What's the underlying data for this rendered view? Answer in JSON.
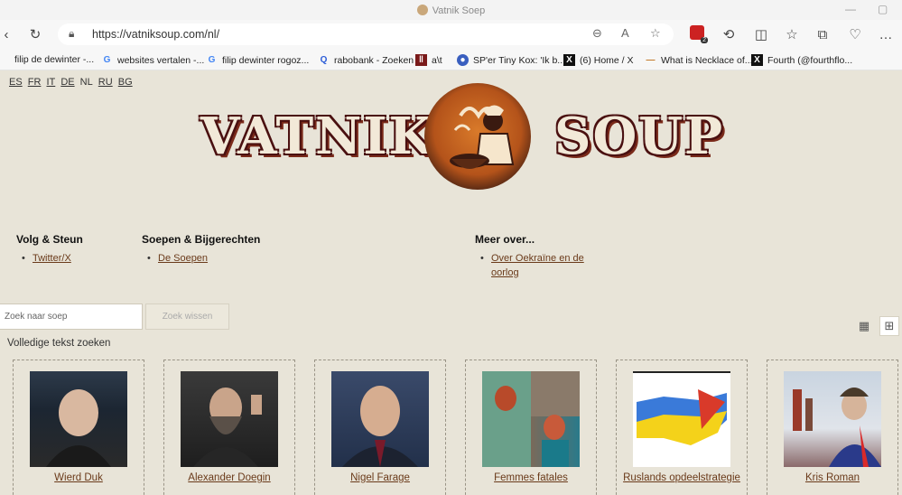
{
  "browser": {
    "tab_title": "Vatnik Soep",
    "url": "https://vatniksoup.com/nl/",
    "extension_badge": "2",
    "bookmarks": [
      {
        "icon": "globe-icon",
        "label": "filip de dewinter -..."
      },
      {
        "icon": "google-icon",
        "label": "websites vertalen -..."
      },
      {
        "icon": "google-icon",
        "label": "filip dewinter rogoz..."
      },
      {
        "icon": "search-icon",
        "label": "rabobank - Zoeken"
      },
      {
        "icon": "site-icon",
        "label": "a\\t"
      },
      {
        "icon": "site-icon",
        "label": "SP'er Tiny Kox: 'Ik b..."
      },
      {
        "icon": "x-icon",
        "label": "(6) Home / X"
      },
      {
        "icon": "dash-icon",
        "label": "What is Necklace of..."
      },
      {
        "icon": "x-icon",
        "label": "Fourth (@fourthflo..."
      }
    ]
  },
  "page": {
    "languages": [
      {
        "code": "ES",
        "link": true
      },
      {
        "code": "FR",
        "link": true
      },
      {
        "code": "IT",
        "link": true
      },
      {
        "code": "DE",
        "link": true
      },
      {
        "code": "NL",
        "link": false
      },
      {
        "code": "RU",
        "link": true
      },
      {
        "code": "BG",
        "link": true
      }
    ],
    "logo": {
      "left_word": "VATNIK",
      "right_word": "SOUP"
    },
    "nav": [
      {
        "heading": "Volg & Steun",
        "items": [
          "Twitter/X"
        ]
      },
      {
        "heading": "Soepen & Bijgerechten",
        "items": [
          "De Soepen"
        ]
      },
      {
        "heading": "Meer over...",
        "items": [
          "Over Oekraïne en de oorlog"
        ]
      }
    ],
    "search": {
      "placeholder": "Zoek naar soep",
      "clear_label": "Zoek wissen",
      "fulltext_label": "Volledige tekst zoeken"
    },
    "view_toggle": {
      "active": "grid"
    },
    "cards": [
      {
        "name": "Wierd Duk"
      },
      {
        "name": "Alexander Doegin"
      },
      {
        "name": "Nigel Farage"
      },
      {
        "name": "Femmes fatales"
      },
      {
        "name": "Ruslands opdeelstrategie"
      },
      {
        "name": "Kris Roman"
      }
    ]
  },
  "colors": {
    "page_bg": "#e8e4d8",
    "link": "#6a3a1a",
    "logo_dark": "#4a1010",
    "logo_orange": "#c4621e"
  }
}
